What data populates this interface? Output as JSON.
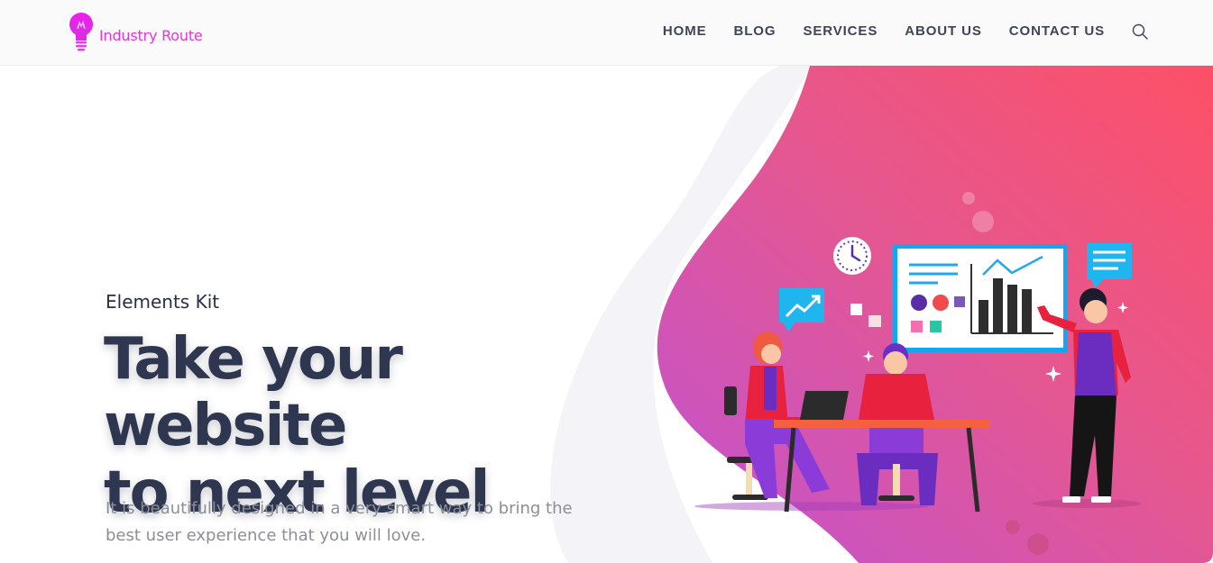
{
  "brand": {
    "name": "Industry Route",
    "accent_color": "#e436d6"
  },
  "nav": {
    "items": [
      {
        "label": "HOME"
      },
      {
        "label": "BLOG"
      },
      {
        "label": "SERVICES"
      },
      {
        "label": "ABOUT US"
      },
      {
        "label": "CONTACT US"
      }
    ],
    "search_icon": "search-icon"
  },
  "hero": {
    "eyebrow": "Elements Kit",
    "headline_line1": "Take your website",
    "headline_line2": "to next level",
    "lead": "It is beautifully designed in a very smart way to bring the best user experience that you will love.",
    "gradient_start": "#c153d2",
    "gradient_end": "#fd5067"
  }
}
